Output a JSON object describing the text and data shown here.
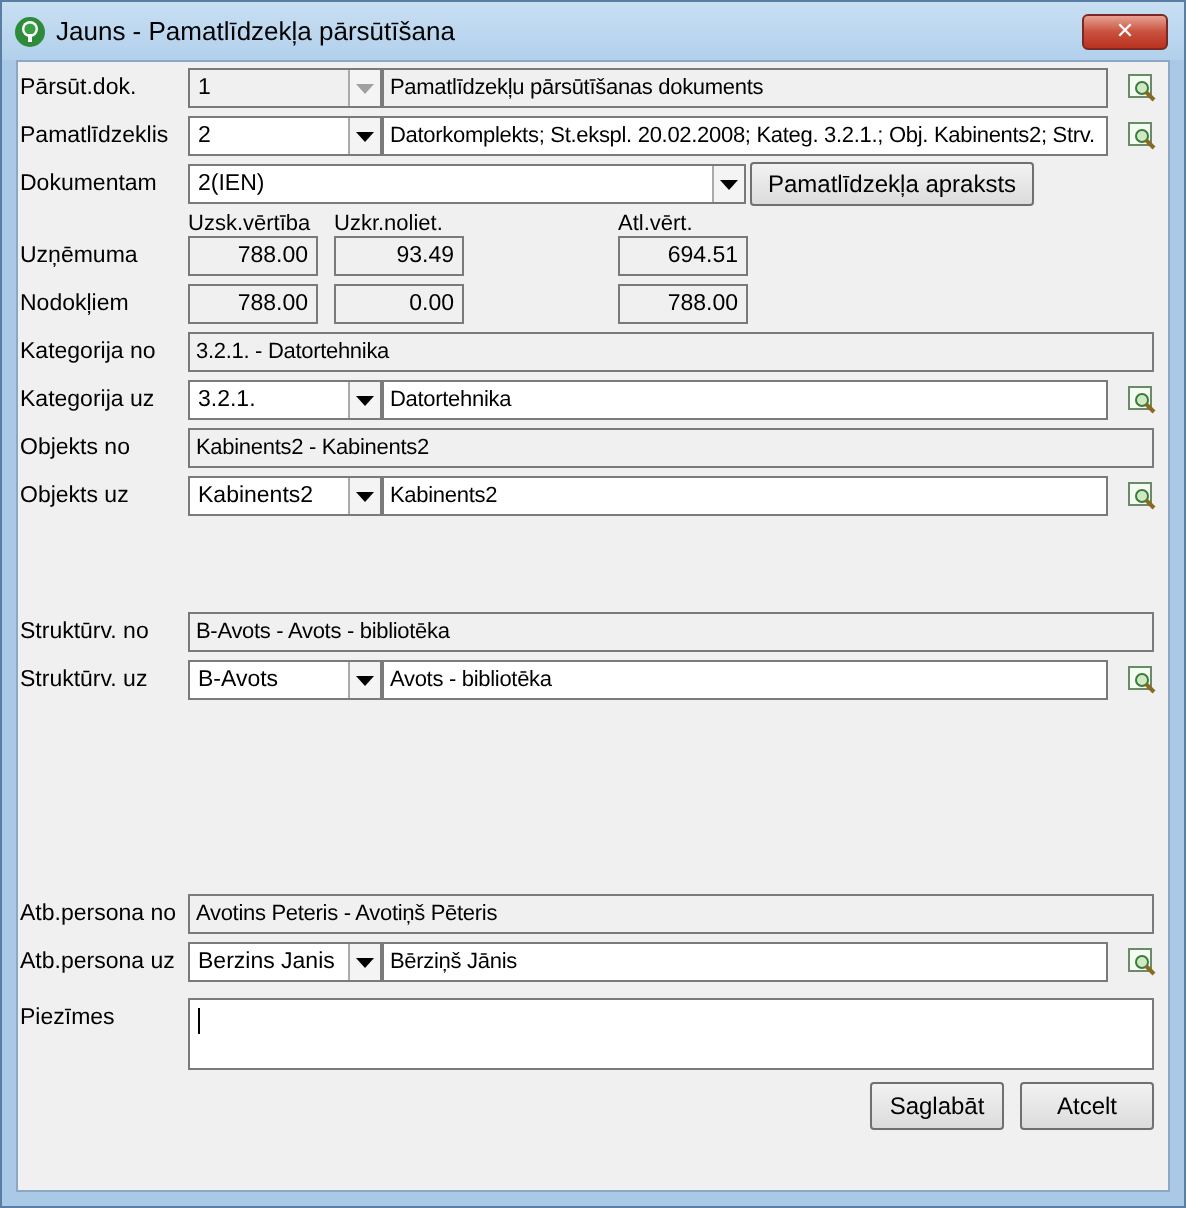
{
  "window": {
    "title": "Jauns - Pamatlīdzekļa pārsūtīšana",
    "close": "✕"
  },
  "groups": [
    [
      {
        "kind": "combo",
        "label": "Pārsūt.dok.",
        "code": "1",
        "text": "Pamatlīdzekļu pārsūtīšanas dokuments",
        "disabled": true
      },
      {
        "kind": "combo",
        "label": "Pamatlīdzeklis",
        "code": "2",
        "text": "Datorkomplekts; St.ekspl. 20.02.2008; Kateg. 3.2.1.; Obj. Kabinents2; Strv.",
        "disabled": false
      },
      {
        "kind": "dropdown",
        "label": "Dokumentam",
        "value": "2(IEN)",
        "button": "Pamatlīdzekļa apraksts"
      },
      {
        "kind": "headers",
        "columns": [
          "Uzsk.vērtība",
          "Uzkr.noliet.",
          "Atl.vērt."
        ]
      },
      {
        "kind": "numbers",
        "label": "Uzņēmuma",
        "values": [
          "788.00",
          "93.49",
          "694.51"
        ]
      },
      {
        "kind": "numbers",
        "label": "Nodokļiem",
        "values": [
          "788.00",
          "0.00",
          "788.00"
        ]
      },
      {
        "kind": "readonly",
        "label": "Kategorija no",
        "value": "3.2.1. - Datortehnika"
      },
      {
        "kind": "combo",
        "label": "Kategorija uz",
        "code": "3.2.1.",
        "text": "Datortehnika",
        "disabled": false
      },
      {
        "kind": "readonly",
        "label": "Objekts no",
        "value": "Kabinents2 - Kabinents2"
      },
      {
        "kind": "combo",
        "label": "Objekts uz",
        "code": "Kabinents2",
        "text": "Kabinents2",
        "disabled": false
      }
    ],
    [
      {
        "kind": "readonly",
        "label": "Struktūrv. no",
        "value": "B-Avots - Avots - bibliotēka"
      },
      {
        "kind": "combo",
        "label": "Struktūrv. uz",
        "code": "B-Avots",
        "text": "Avots - bibliotēka",
        "disabled": false
      }
    ],
    [
      {
        "kind": "readonly",
        "label": "Atb.persona no",
        "value": "Avotins Peteris - Avotiņš Pēteris"
      },
      {
        "kind": "combo",
        "label": "Atb.persona uz",
        "code": "Berzins Janis",
        "text": "Bērziņš Jānis",
        "disabled": false
      },
      {
        "kind": "memo",
        "label": "Piezīmes"
      }
    ]
  ],
  "buttons": [
    "Saglabāt",
    "Atcelt"
  ]
}
